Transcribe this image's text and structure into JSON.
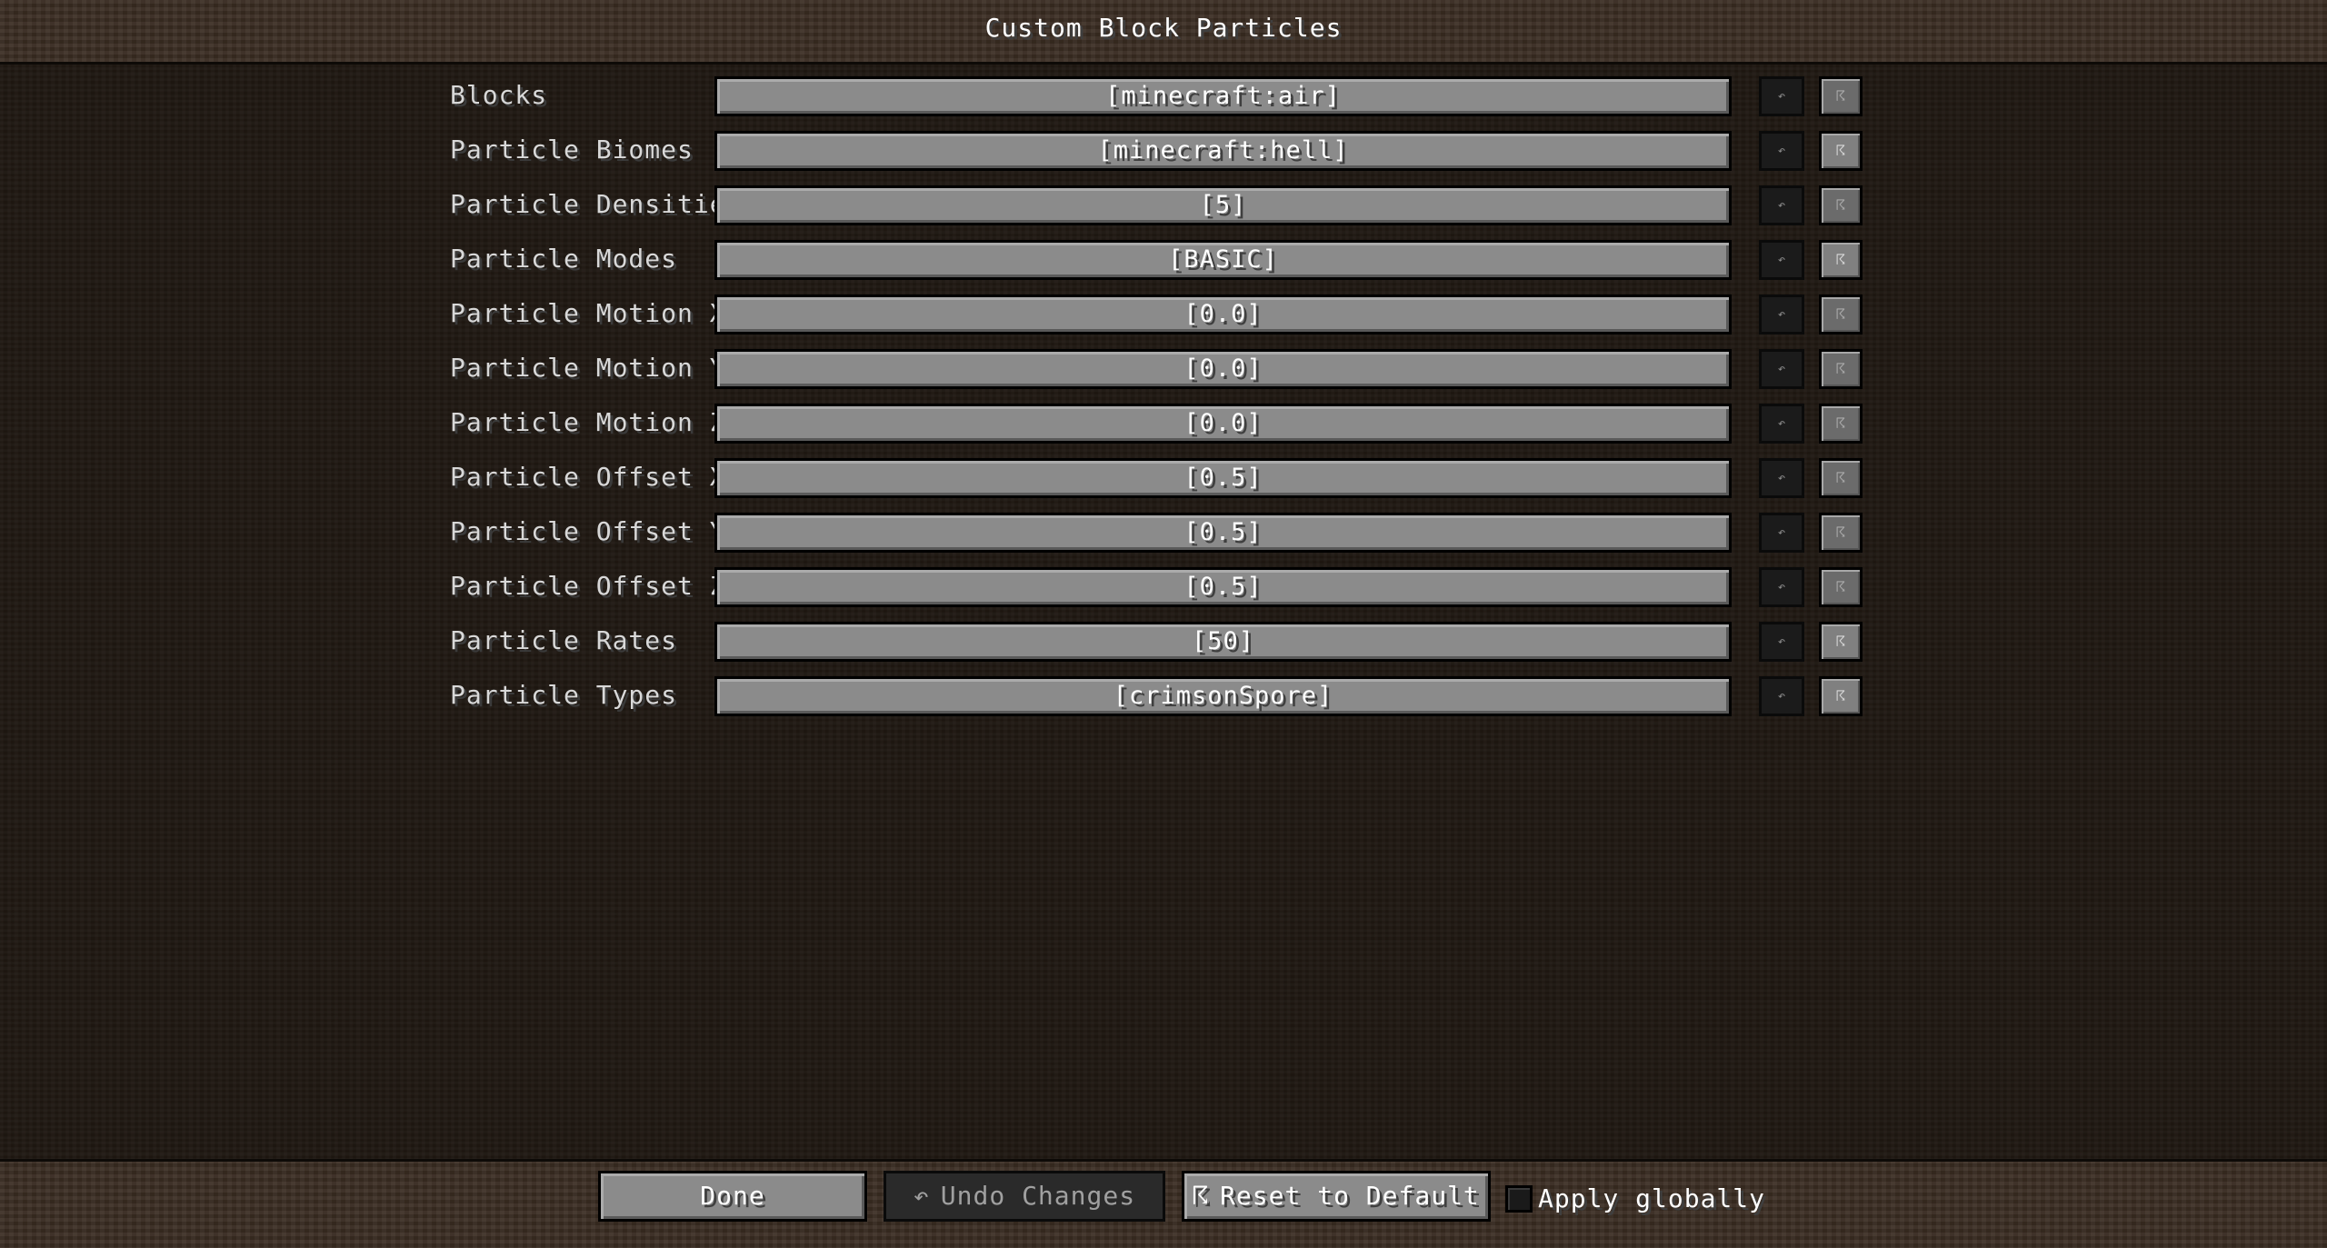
{
  "title": "Custom Block Particles",
  "rows": [
    {
      "label": "Blocks",
      "value": "[minecraft:air]"
    },
    {
      "label": "Particle Biomes",
      "value": "[minecraft:hell]"
    },
    {
      "label": "Particle Densities",
      "value": "[5]"
    },
    {
      "label": "Particle Modes",
      "value": "[BASIC]"
    },
    {
      "label": "Particle Motion X",
      "value": "[0.0]"
    },
    {
      "label": "Particle Motion Y",
      "value": "[0.0]"
    },
    {
      "label": "Particle Motion Z",
      "value": "[0.0]"
    },
    {
      "label": "Particle Offset X",
      "value": "[0.5]"
    },
    {
      "label": "Particle Offset Y",
      "value": "[0.5]"
    },
    {
      "label": "Particle Offset Z",
      "value": "[0.5]"
    },
    {
      "label": "Particle Rates",
      "value": "[50]"
    },
    {
      "label": "Particle Types",
      "value": "[crimsonSpore]"
    }
  ],
  "row_actions": {
    "undo_glyph": "↶",
    "reset_glyph": "☈",
    "undo_icon": "undo-arrow-icon",
    "reset_icon": "reset-broom-icon"
  },
  "footer": {
    "done_label": "Done",
    "undo_glyph": "↶",
    "undo_label": "Undo Changes",
    "reset_glyph": "☈",
    "reset_label": "Reset to Default",
    "apply_globally_label": "Apply globally",
    "apply_globally_checked": false
  },
  "colors": {
    "background": "#1f1812",
    "band": "#3a2c22",
    "button": "#8b8b8b",
    "button_disabled": "#2a2a2a",
    "text": "#ffffff"
  }
}
